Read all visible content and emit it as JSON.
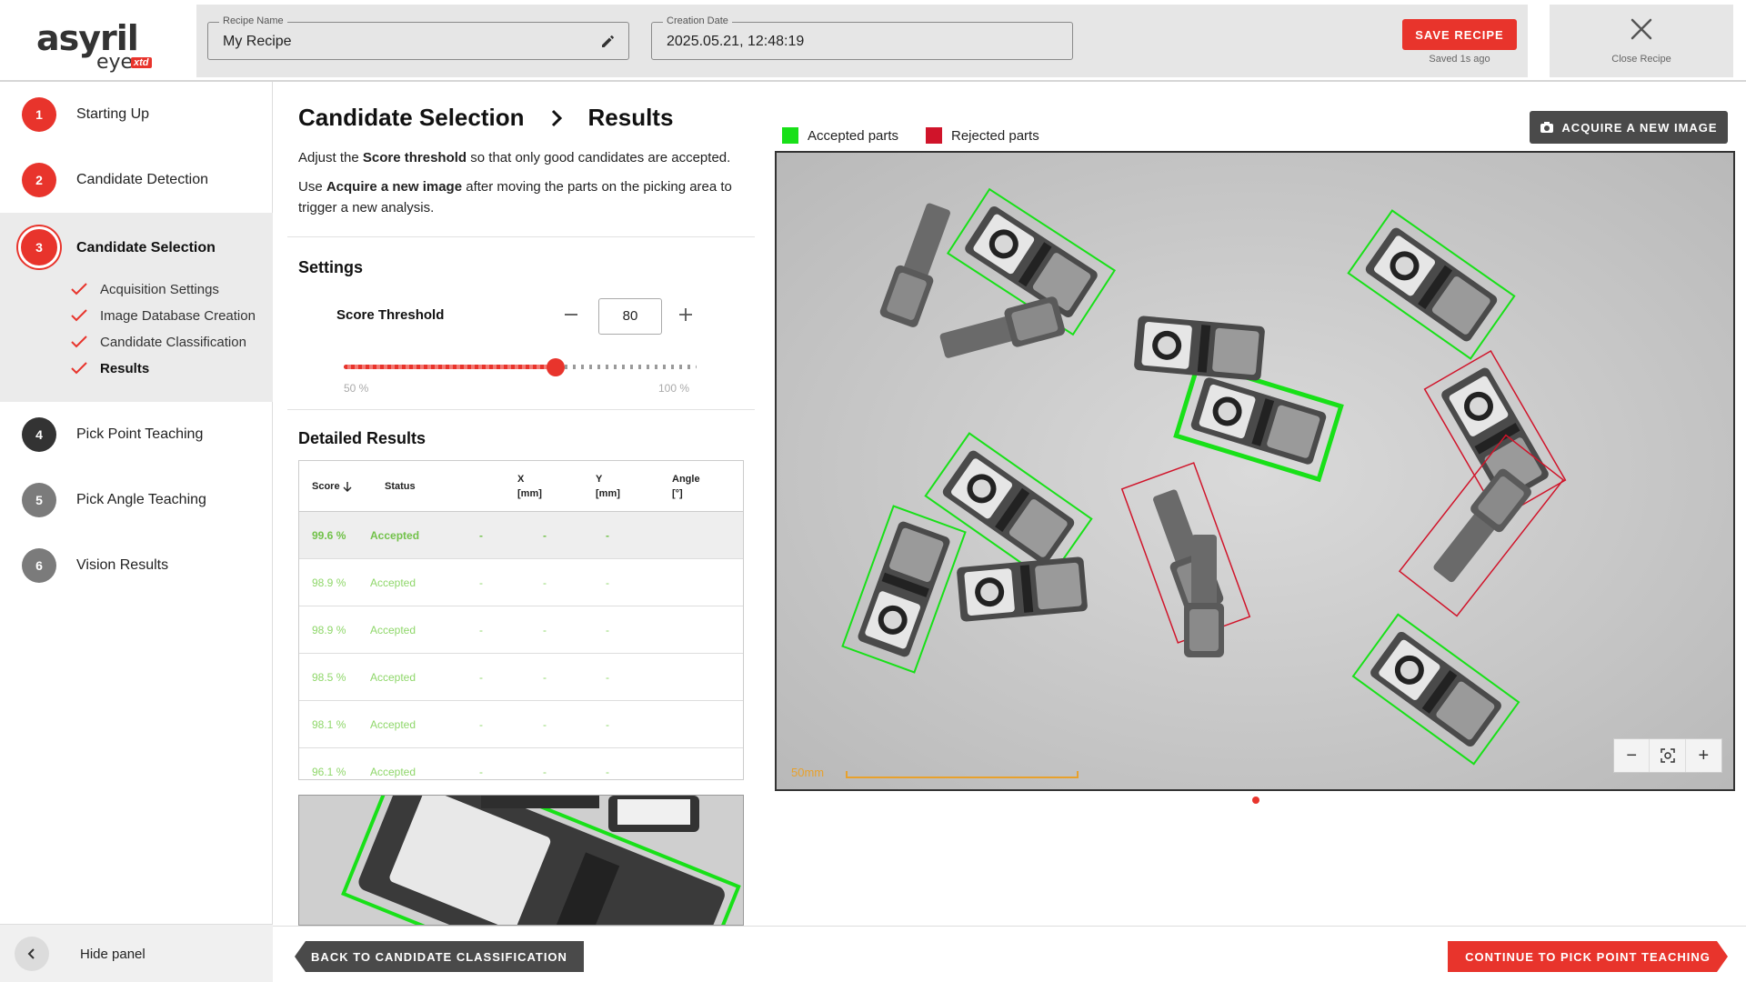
{
  "app": {
    "logo_main": "asyril",
    "logo_sub": "eye",
    "logo_badge": "xtd"
  },
  "header": {
    "recipe_name_label": "Recipe Name",
    "recipe_name_value": "My Recipe",
    "creation_date_label": "Creation Date",
    "creation_date_value": "2025.05.21, 12:48:19",
    "save_label": "SAVE RECIPE",
    "saved_status": "Saved 1s ago",
    "close_label": "Close Recipe"
  },
  "sidebar": {
    "steps": [
      {
        "num": "1",
        "label": "Starting Up"
      },
      {
        "num": "2",
        "label": "Candidate Detection"
      },
      {
        "num": "3",
        "label": "Candidate Selection"
      },
      {
        "num": "4",
        "label": "Pick Point Teaching"
      },
      {
        "num": "5",
        "label": "Pick Angle Teaching"
      },
      {
        "num": "6",
        "label": "Vision Results"
      }
    ],
    "substeps": [
      "Acquisition Settings",
      "Image Database Creation",
      "Candidate Classification",
      "Results"
    ],
    "hide_panel": "Hide panel"
  },
  "main": {
    "breadcrumb": [
      "Candidate Selection",
      "Results"
    ],
    "intro1": {
      "pre": "Adjust the ",
      "bold": "Score threshold",
      "post": " so that only good candidates are accepted."
    },
    "intro2": {
      "pre": "Use ",
      "bold": "Acquire a new image",
      "post": " after moving the parts on the picking area to trigger a new analysis."
    },
    "settings_title": "Settings",
    "threshold_label": "Score Threshold",
    "threshold_value": "80",
    "slider_min_label": "50 %",
    "slider_max_label": "100 %",
    "slider_min": 50,
    "slider_max": 100,
    "results_title": "Detailed Results",
    "table": {
      "headers": [
        "Score",
        "Status",
        "X\n[mm]",
        "Y\n[mm]",
        "Angle\n[°]"
      ],
      "rows": [
        [
          "99.6 %",
          "Accepted",
          "-",
          "-",
          "-"
        ],
        [
          "98.9 %",
          "Accepted",
          "-",
          "-",
          "-"
        ],
        [
          "98.9 %",
          "Accepted",
          "-",
          "-",
          "-"
        ],
        [
          "98.5 %",
          "Accepted",
          "-",
          "-",
          "-"
        ],
        [
          "98.1 %",
          "Accepted",
          "-",
          "-",
          "-"
        ],
        [
          "96.1 %",
          "Accepted",
          "-",
          "-",
          "-"
        ]
      ]
    }
  },
  "image_panel": {
    "legend_accepted": "Accepted parts",
    "legend_rejected": "Rejected parts",
    "acquire_label": "ACQUIRE A NEW IMAGE",
    "scale_label": "50mm",
    "accepted_color": "#18e018",
    "rejected_color": "#d0142a",
    "zoom_out": "−",
    "zoom_in": "+"
  },
  "footer": {
    "back_label": "BACK TO CANDIDATE CLASSIFICATION",
    "continue_label": "CONTINUE TO PICK POINT TEACHING"
  },
  "colors": {
    "accent": "#e8342c",
    "dark": "#4a4a4a",
    "accepted_text": "#8fd76a"
  }
}
